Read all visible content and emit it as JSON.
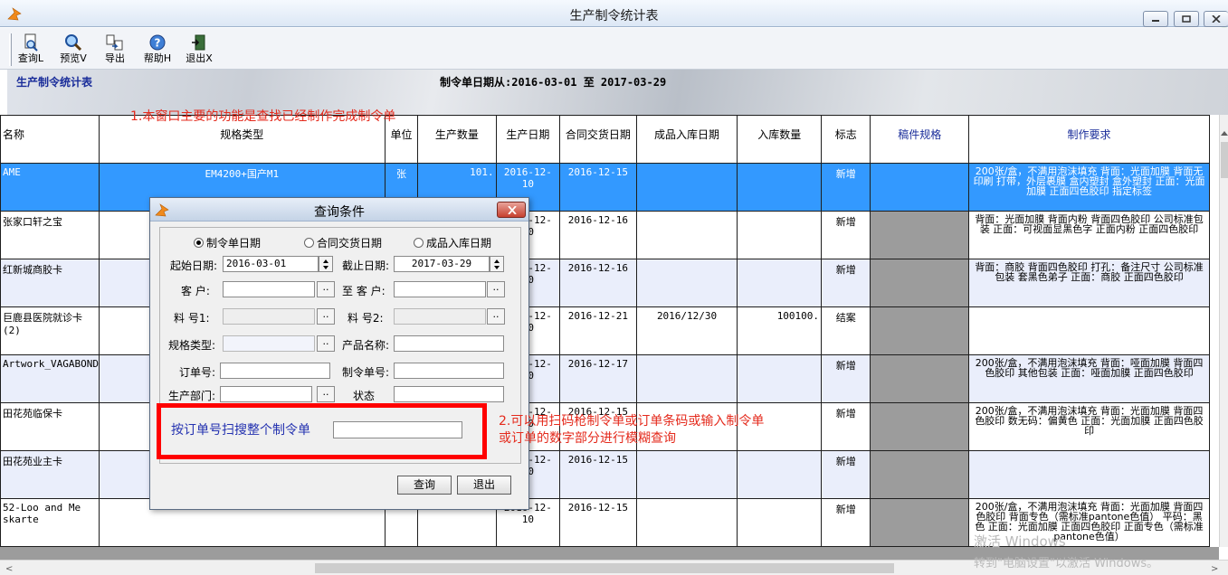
{
  "window": {
    "title": "生产制令统计表"
  },
  "toolbar": {
    "query": "查询L",
    "preview": "预览V",
    "export": "导出",
    "help": "帮助H",
    "exit": "退出X"
  },
  "report": {
    "title": "生产制令统计表",
    "date_range": "制令单日期从:2016-03-01 至 2017-03-29"
  },
  "annotations": {
    "note1": "1.本窗口主要的功能是查找已经制作完成制令单",
    "note2": "2.可以用扫码枪制令单或订单条码或输入制令单或订单的数字部分进行模糊查询"
  },
  "grid": {
    "columns": [
      "名称",
      "规格类型",
      "单位",
      "生产数量",
      "生产日期",
      "合同交货日期",
      "成品入库日期",
      "入库数量",
      "标志",
      "稿件规格",
      "制作要求"
    ],
    "rows": [
      {
        "name": "AME",
        "spec": "EM4200+国产M1",
        "unit": "张",
        "qty": "101.",
        "prod_date": "2016-12-10",
        "due_date": "2016-12-15",
        "in_date": "",
        "in_qty": "",
        "flag": "新增",
        "req": "200张/盒，不满用泡沫填充  背面：光面加膜  背面无印刷  打带，外层裹膜  盒内塑封  盒外塑封  正面：光面加膜  正面四色胶印  指定标签"
      },
      {
        "name": "张家口轩之宝",
        "spec": "",
        "unit": "",
        "qty": "",
        "prod_date": "2016-12-10",
        "due_date": "2016-12-16",
        "in_date": "",
        "in_qty": "",
        "flag": "新增",
        "req": "背面：光面加膜  背面内粉  背面四色胶印  公司标准包装  正面：可视面显黑色字  正面内粉  正面四色胶印"
      },
      {
        "name": "红新城商胶卡",
        "spec": "",
        "unit": "",
        "qty": "",
        "prod_date": "2016-12-10",
        "due_date": "2016-12-16",
        "in_date": "",
        "in_qty": "",
        "flag": "新增",
        "req": "背面：商胶  背面四色胶印  打孔：备注尺寸  公司标准包装  套黑色弟子  正面：商胶  正面四色胶印"
      },
      {
        "name": "巨鹿县医院就诊卡(2)",
        "spec": "",
        "unit": "",
        "qty": "",
        "prod_date": "2016-12-10",
        "due_date": "2016-12-21",
        "in_date": "2016/12/30",
        "in_qty": "100100.",
        "flag": "结案",
        "req": ""
      },
      {
        "name": "Artwork_VAGABOND",
        "spec": "",
        "unit": "",
        "qty": "",
        "prod_date": "2016-12-10",
        "due_date": "2016-12-17",
        "in_date": "",
        "in_qty": "",
        "flag": "新增",
        "req": "200张/盒，不满用泡沫填充  背面：哑面加膜  背面四色胶印  其他包装  正面：哑面加膜  正面四色胶印"
      },
      {
        "name": "田花苑临保卡",
        "spec": "",
        "unit": "",
        "qty": "",
        "prod_date": "2016-12-10",
        "due_date": "2016-12-15",
        "in_date": "",
        "in_qty": "",
        "flag": "新增",
        "req": "200张/盒，不满用泡沫填充  背面：光面加膜  背面四色胶印  数无码：偏黄色  正面：光面加膜  正面四色胶印"
      },
      {
        "name": "田花苑业主卡",
        "spec": "",
        "unit": "",
        "qty": "",
        "prod_date": "2016-12-10",
        "due_date": "2016-12-15",
        "in_date": "",
        "in_qty": "",
        "flag": "新增",
        "req": ""
      },
      {
        "name": "52-Loo and Me skarte",
        "spec": "",
        "unit": "",
        "qty": "",
        "prod_date": "2016-12-10",
        "due_date": "2016-12-15",
        "in_date": "",
        "in_qty": "",
        "flag": "新增",
        "req": "200张/盒，不满用泡沫填充  背面：光面加膜  背面四色胶印  背面专色（需标准pantone色值）  平码：黑色  正面：光面加膜  正面四色胶印  正面专色（需标准pantone色值）"
      }
    ]
  },
  "dialog": {
    "title": "查询条件",
    "radio_order_date": "制令单日期",
    "radio_delivery_date": "合同交货日期",
    "radio_warehouse_date": "成品入库日期",
    "start_label": "起始日期:",
    "start_value": "2016-03-01",
    "end_label": "截止日期:",
    "end_value": "2017-03-29",
    "customer_label": "客  户:",
    "to_customer_label": "至 客 户:",
    "material1_label": "料  号1:",
    "material2_label": "料  号2:",
    "spec_label": "规格类型:",
    "product_label": "产品名称:",
    "order_label": "订单号:",
    "mo_label": "制令单号:",
    "dept_label": "生产部门:",
    "status_label": "状态",
    "dots": "..",
    "scan_label": "按订单号扫搜整个制令单",
    "query_btn": "查询",
    "exit_btn": "退出"
  },
  "watermark": {
    "line1": "激活 Windows",
    "line2": "转到\"电脑设置\"以激活 Windows。"
  }
}
